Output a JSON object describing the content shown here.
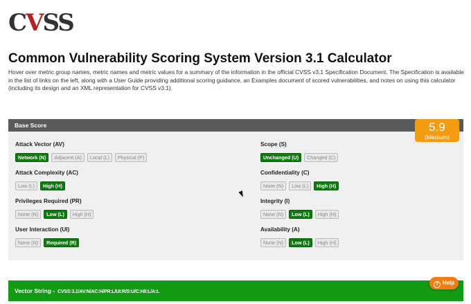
{
  "logo": {
    "part1": "C",
    "part2": "V",
    "part3": "SS"
  },
  "title": "Common Vulnerability Scoring System Version 3.1 Calculator",
  "intro": "Hover over metric group names, metric names and metric values for a summary of the information in the official CVSS v3.1 Specification Document. The Specification is available in the list of links on the left, along with a User Guide providing additional scoring guidance, an Examples document of scored vulnerabilities, and notes on using this calculator (including its design and an XML representation for CVSS v3.1).",
  "base": {
    "header": "Base Score",
    "score": "5.9",
    "severity": "(Medium)",
    "metrics": {
      "attack_vector": {
        "label": "Attack Vector (AV)",
        "options": [
          "Network (N)",
          "Adjacent (A)",
          "Local (L)",
          "Physical (P)"
        ],
        "selected": "Network (N)"
      },
      "attack_complexity": {
        "label": "Attack Complexity (AC)",
        "options": [
          "Low (L)",
          "High (H)"
        ],
        "selected": "High (H)"
      },
      "privileges_required": {
        "label": "Privileges Required (PR)",
        "options": [
          "None (N)",
          "Low (L)",
          "High (H)"
        ],
        "selected": "Low (L)"
      },
      "user_interaction": {
        "label": "User Interaction (UI)",
        "options": [
          "None (N)",
          "Required (R)"
        ],
        "selected": "Required (R)"
      },
      "scope": {
        "label": "Scope (S)",
        "options": [
          "Unchanged (U)",
          "Changed (C)"
        ],
        "selected": "Unchanged (U)"
      },
      "confidentiality": {
        "label": "Confidentiality (C)",
        "options": [
          "None (N)",
          "Low (L)",
          "High (H)"
        ],
        "selected": "High (H)"
      },
      "integrity": {
        "label": "Integrity (I)",
        "options": [
          "None (N)",
          "Low (L)",
          "High (H)"
        ],
        "selected": "Low (L)"
      },
      "availability": {
        "label": "Availability (A)",
        "options": [
          "None (N)",
          "Low (L)",
          "High (H)"
        ],
        "selected": "Low (L)"
      }
    }
  },
  "vector": {
    "label": "Vector String -",
    "value": "CVSS:3.1/AV:N/AC:H/PR:L/UI:R/S:U/C:H/I:L/A:L"
  },
  "help": {
    "label": "Help",
    "icon": "?"
  },
  "colors": {
    "selected": "#0f7a0f",
    "score_badge": "#f39c12",
    "vector_bar": "#149a14",
    "help_button": "#ef7d0f",
    "logo_accent": "#b8202a"
  }
}
